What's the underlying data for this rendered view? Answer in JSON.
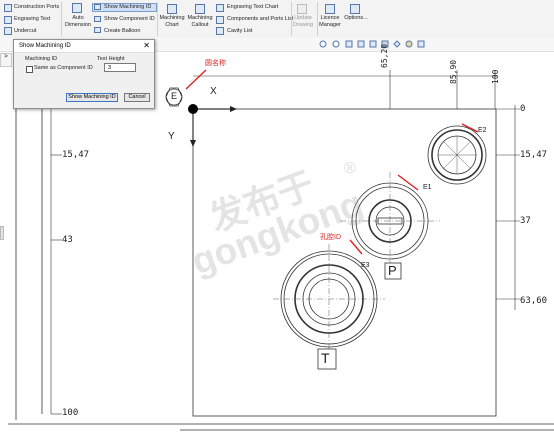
{
  "ribbon": {
    "construction_ports": "Construction Ports",
    "engraving_text": "Engraving Text",
    "undercut": "Undercut",
    "auto_dimension_line1": "Auto",
    "auto_dimension_line2": "Dimension",
    "show_machining_id": "Show Machining ID",
    "show_component_id": "Show Component ID",
    "create_balloon": "Create Balloon",
    "machining_chart_line1": "Machining",
    "machining_chart_line2": "Chart",
    "machining_callout_line1": "Machining",
    "machining_callout_line2": "Callout",
    "engraving_text_chart": "Engraving Text Chart",
    "components_ports_list": "Components and Ports List",
    "cavity_list": "Cavity List",
    "update_drawing_line1": "Update",
    "update_drawing_line2": "Drawing",
    "licence_manager_line1": "Licence",
    "licence_manager_line2": "Manager",
    "options": "Options..."
  },
  "dialog": {
    "title": "Show Machining ID",
    "machining_id_label": "Machining ID",
    "same_as_component_label": "Same as Component ID",
    "same_as_component_checked": false,
    "text_height_label": "Text Height",
    "text_height_value": "3",
    "show_button": "Show Machining ID",
    "cancel_button": "Cancel"
  },
  "drawing": {
    "datum_label": "E",
    "axis_x": "X",
    "axis_y": "Y",
    "top_dims": [
      "65,20",
      "85,90",
      "100"
    ],
    "right_dims": [
      "0",
      "15,47",
      "37",
      "63,60"
    ],
    "left_dims": [
      "15,47",
      "43",
      "100"
    ],
    "hole_ids": [
      "E1",
      "E2",
      "E3"
    ],
    "port_letters": [
      "P",
      "T"
    ],
    "annotations": {
      "round_name": "圆名称",
      "hole_id": "孔腔ID"
    }
  },
  "watermark": {
    "line1": "发布于",
    "line2": "gongkong",
    "mark": "®"
  }
}
